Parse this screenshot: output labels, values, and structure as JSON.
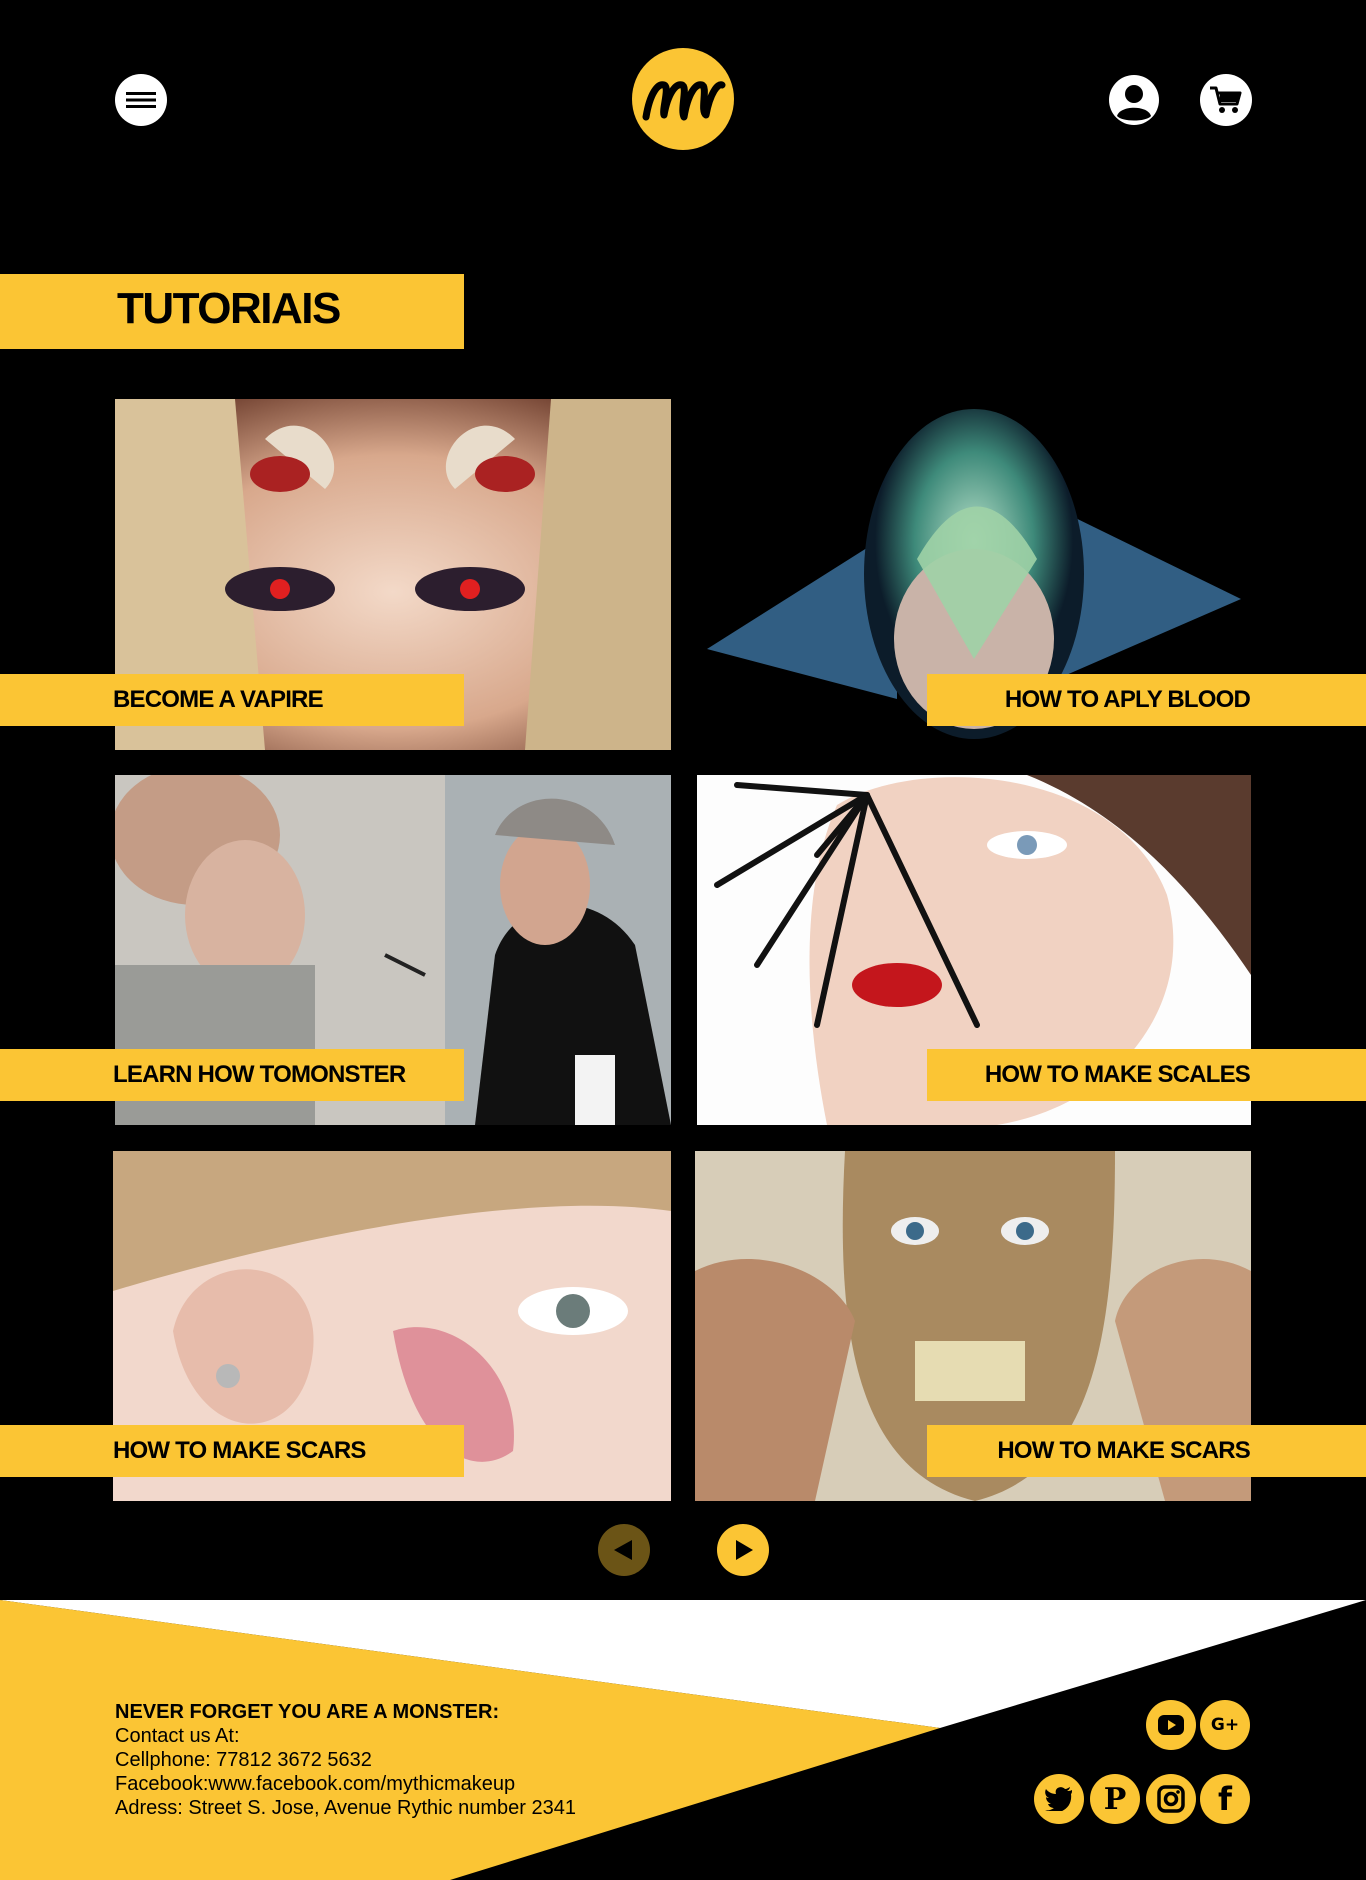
{
  "header": {
    "menu_icon": "hamburger-menu-icon",
    "logo_text": "mm",
    "account_icon": "user-account-icon",
    "cart_icon": "shopping-cart-icon"
  },
  "page": {
    "title": "TUTORIAIS"
  },
  "tutorials": [
    {
      "label": "BECOME A VAPIRE",
      "image": "demon horned woman makeup"
    },
    {
      "label": "HOW TO APLY BLOOD",
      "image": "fantasy fish creature mask"
    },
    {
      "label": "LEARN HOW TOMONSTER",
      "image": "artist applying alien prosthetic"
    },
    {
      "label": "HOW TO MAKE SCALES",
      "image": "spider leg eye makeup"
    },
    {
      "label": "HOW TO MAKE SCARS",
      "image": "glitter wound on cheek"
    },
    {
      "label": "HOW TO MAKE SCARS",
      "image": "zombie face prosthetic"
    }
  ],
  "pagination": {
    "prev_icon": "previous-arrow-icon",
    "next_icon": "next-arrow-icon"
  },
  "footer": {
    "tagline": "NEVER FORGET YOU ARE A MONSTER:",
    "contact": "Contact us At:",
    "phone": "Cellphone: 77812 3672 5632",
    "facebook": "Facebook:www.facebook.com/mythicmakeup",
    "address": "Adress: Street S. Jose, Avenue Rythic number 2341",
    "social": {
      "youtube": "youtube-icon",
      "googleplus_text": "G+",
      "twitter": "twitter-icon",
      "pinterest_text": "P",
      "instagram": "instagram-icon",
      "facebook_text": "f"
    }
  },
  "colors": {
    "accent": "#fbc534",
    "background": "#000000",
    "text": "#000000"
  }
}
